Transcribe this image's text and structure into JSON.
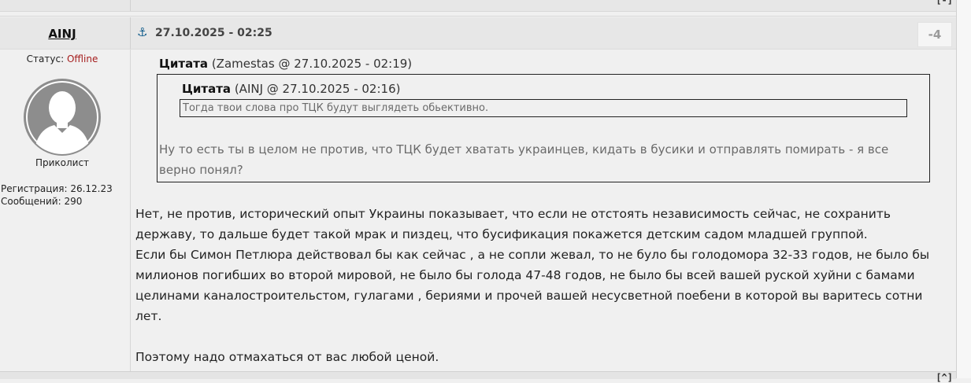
{
  "top_bar": {
    "control": "[-]"
  },
  "bottom_bar": {
    "control": "[^]"
  },
  "post": {
    "author": "AINJ",
    "date": "27.10.2025 - 02:25",
    "rating": "-4",
    "anchor_icon": "anchor-icon",
    "profile": {
      "status_label": "Статус:",
      "status_value": "Offline",
      "rank": "Приколист",
      "registration": "Регистрация: 26.12.23",
      "messages": "Сообщений: 290"
    },
    "quote": {
      "label": "Цитата",
      "meta": " (Zamestas @ 27.10.2025 - 02:19)",
      "nested_quote": {
        "label": "Цитата",
        "meta": " (AINJ @ 27.10.2025 - 02:16)",
        "text": "Тогда твои слова про ТЦК будут выглядеть обьективно."
      },
      "text": "Ну то есть ты в целом не против, что ТЦК будет хватать украинцев, кидать в бусики и отправлять помирать - я все верно понял?"
    },
    "body_text": "Нет, не против, исторический опыт Украины показывает, что если не отстоять независимость сейчас, не сохранить державу, то дальше будет такой мрак и пиздец, что бусификация покажется детским садом младшей группой.\nЕсли бы Симон Петлюра действовал бы как сейчас , а не сопли жевал, то не було бы голодомора 32-33 годов, не было бы милионов погибших во второй мировой, не было бы голода 47-48 годов, не было бы всей вашей руской хуйни с бамами целинами каналостроительстом, гулагами , бериями и прочей вашей несусветной поебени в которой вы варитесь сотни лет.\n\nПоэтому надо отмахаться от вас любой ценой."
  }
}
